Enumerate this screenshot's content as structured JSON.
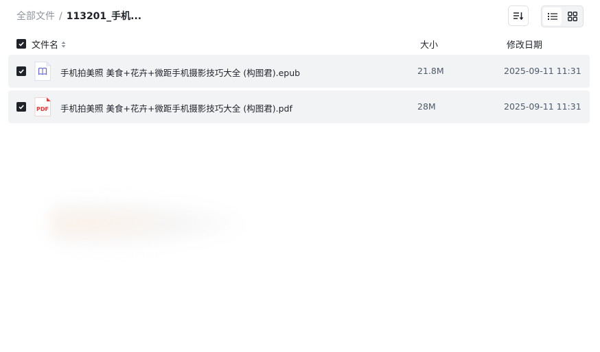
{
  "breadcrumb": {
    "root": "全部文件",
    "separator": "/",
    "current": "113201_手机..."
  },
  "toolbar": {
    "sort_icon": "sort-lines-icon",
    "list_view_icon": "list-view-icon",
    "grid_view_icon": "grid-view-icon",
    "active_view": "list"
  },
  "table": {
    "columns": {
      "name": "文件名",
      "size": "大小",
      "modified": "修改日期"
    },
    "rows": [
      {
        "name": "手机拍美照 美食+花卉+微距手机摄影技巧大全 (构图君).epub",
        "size": "21.8M",
        "modified": "2025-09-11 11:31",
        "icon": "epub-book-icon",
        "checked": true
      },
      {
        "name": "手机拍美照 美食+花卉+微距手机摄影技巧大全 (构图君).pdf",
        "size": "28M",
        "modified": "2025-09-11 11:31",
        "icon": "pdf-file-icon",
        "icon_text": "PDF",
        "checked": true
      }
    ]
  },
  "colors": {
    "row_background": "#f2f3f5",
    "checkbox": "#1f2329",
    "epub_accent": "#6e6cd8",
    "pdf_accent": "#e1393c",
    "muted_text": "#8f959e"
  }
}
